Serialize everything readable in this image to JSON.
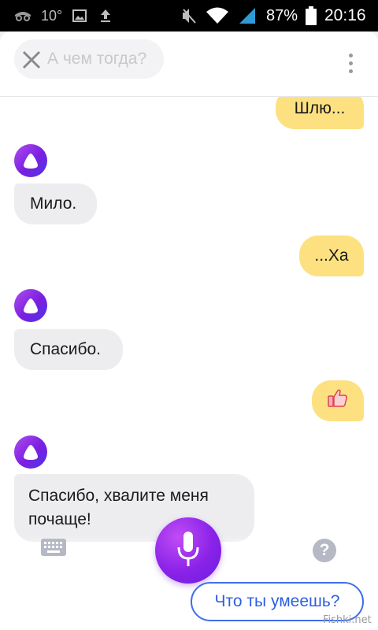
{
  "status_bar": {
    "temperature": "10°",
    "battery": "87%",
    "time": "20:16",
    "icons": [
      "incognito-icon",
      "image-icon",
      "upload-icon",
      "mute-icon",
      "wifi-icon",
      "signal-icon",
      "battery-icon"
    ]
  },
  "header": {
    "query": "А чем тогда?",
    "close_icon": "close-icon",
    "menu_icon": "more-vert-icon"
  },
  "messages": [
    {
      "from": "user",
      "text": "Шлю..."
    },
    {
      "from": "bot",
      "text": "Мило."
    },
    {
      "from": "user",
      "text": "...Ха"
    },
    {
      "from": "bot",
      "text": "Спасибо."
    },
    {
      "from": "user",
      "text": "",
      "sticker": "thumbs-up-icon"
    },
    {
      "from": "bot",
      "text": "Спасибо, хвалите меня почаще!"
    }
  ],
  "bottom": {
    "keyboard_icon": "keyboard-icon",
    "mic_icon": "microphone-icon",
    "help_label": "?",
    "suggestion": "Что ты умеешь?"
  },
  "watermark": "Fishki.net",
  "colors": {
    "user_bubble": "#fde181",
    "bot_bubble": "#ededf0",
    "accent": "#8a22e8",
    "suggestion_border": "#3f6fe8"
  }
}
